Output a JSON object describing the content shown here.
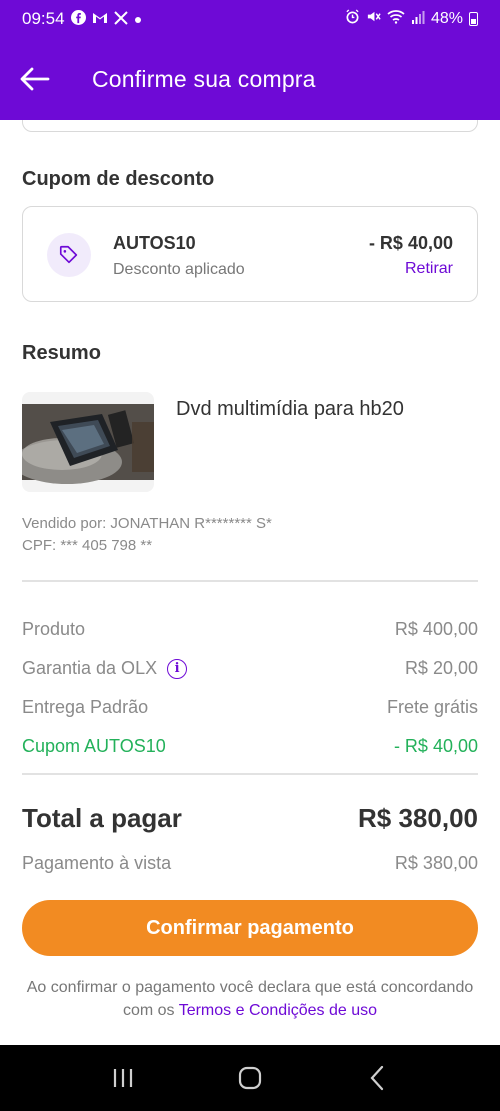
{
  "status_bar": {
    "time": "09:54",
    "notification_icons": [
      "facebook-icon",
      "gmail-icon",
      "x-icon",
      "dot-icon"
    ],
    "system_icons": [
      "alarm-icon",
      "mute-icon",
      "wifi-icon",
      "signal-icon"
    ],
    "battery": "48%"
  },
  "header": {
    "title": "Confirme sua compra"
  },
  "coupon_section": {
    "title": "Cupom de desconto",
    "code": "AUTOS10",
    "status": "Desconto aplicado",
    "amount": "- R$ 40,00",
    "remove_label": "Retirar"
  },
  "summary": {
    "title": "Resumo",
    "product_name": "Dvd multimídia para hb20",
    "seller_line": "Vendido por: JONATHAN R******** S*",
    "cpf_line": "CPF: *** 405 798 **"
  },
  "price_rows": [
    {
      "label": "Produto",
      "value": "R$ 400,00"
    },
    {
      "label": "Garantia da OLX",
      "value": "R$ 20,00"
    },
    {
      "label": "Entrega Padrão",
      "value": "Frete grátis"
    },
    {
      "label": "Cupom AUTOS10",
      "value": "- R$ 40,00"
    }
  ],
  "total": {
    "label": "Total a pagar",
    "value": "R$ 380,00"
  },
  "payment": {
    "label": "Pagamento à vista",
    "value": "R$ 380,00"
  },
  "confirm_button": "Confirmar pagamento",
  "terms": {
    "text": "Ao confirmar o pagamento você declara que está concordando com os",
    "link": "Termos e Condições de uso"
  },
  "colors": {
    "brand_purple": "#6e0ad6",
    "accent_orange": "#f28b22",
    "discount_green": "#23b15a"
  }
}
